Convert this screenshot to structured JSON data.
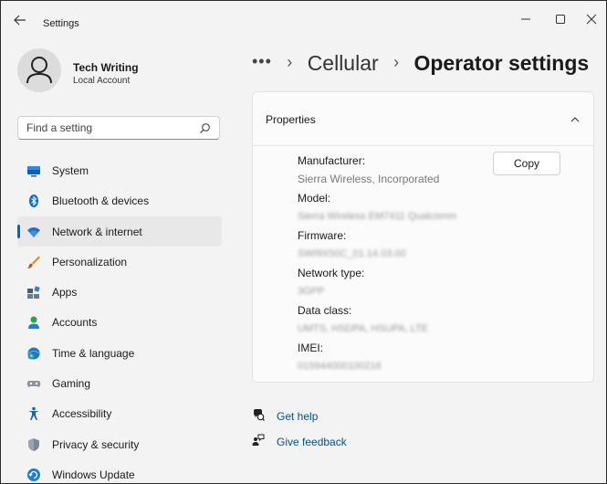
{
  "window": {
    "title": "Settings",
    "controls": {
      "minimize": "minimize",
      "maximize": "maximize",
      "close": "close"
    }
  },
  "profile": {
    "name": "Tech Writing",
    "account_type": "Local Account"
  },
  "search": {
    "placeholder": "Find a setting"
  },
  "sidebar": {
    "items": [
      {
        "label": "System",
        "icon": "system-icon",
        "active": false
      },
      {
        "label": "Bluetooth & devices",
        "icon": "bluetooth-icon",
        "active": false
      },
      {
        "label": "Network & internet",
        "icon": "wifi-icon",
        "active": true
      },
      {
        "label": "Personalization",
        "icon": "brush-icon",
        "active": false
      },
      {
        "label": "Apps",
        "icon": "apps-icon",
        "active": false
      },
      {
        "label": "Accounts",
        "icon": "person-icon",
        "active": false
      },
      {
        "label": "Time & language",
        "icon": "globe-clock-icon",
        "active": false
      },
      {
        "label": "Gaming",
        "icon": "gamepad-icon",
        "active": false
      },
      {
        "label": "Accessibility",
        "icon": "accessibility-icon",
        "active": false
      },
      {
        "label": "Privacy & security",
        "icon": "shield-icon",
        "active": false
      },
      {
        "label": "Windows Update",
        "icon": "update-icon",
        "active": false
      }
    ]
  },
  "breadcrumb": {
    "ellipsis": "•••",
    "parent": "Cellular",
    "current": "Operator settings"
  },
  "properties": {
    "title": "Properties",
    "copy_label": "Copy",
    "manufacturer_label": "Manufacturer:",
    "manufacturer_value": "Sierra Wireless, Incorporated",
    "model_label": "Model:",
    "model_value": "Sierra Wireless EM7411 Qualcomm",
    "firmware_label": "Firmware:",
    "firmware_value": "SWI9X50C_01.14.03.00",
    "network_type_label": "Network type:",
    "network_type_value": "3GPP",
    "data_class_label": "Data class:",
    "data_class_value": "UMTS, HSDPA, HSUPA, LTE",
    "imei_label": "IMEI:",
    "imei_value": "015944000100216"
  },
  "links": {
    "get_help": "Get help",
    "give_feedback": "Give feedback"
  },
  "colors": {
    "accent": "#0067c0",
    "link": "#0050a0",
    "background": "#f3f3f3",
    "card": "#fbfbfb"
  }
}
